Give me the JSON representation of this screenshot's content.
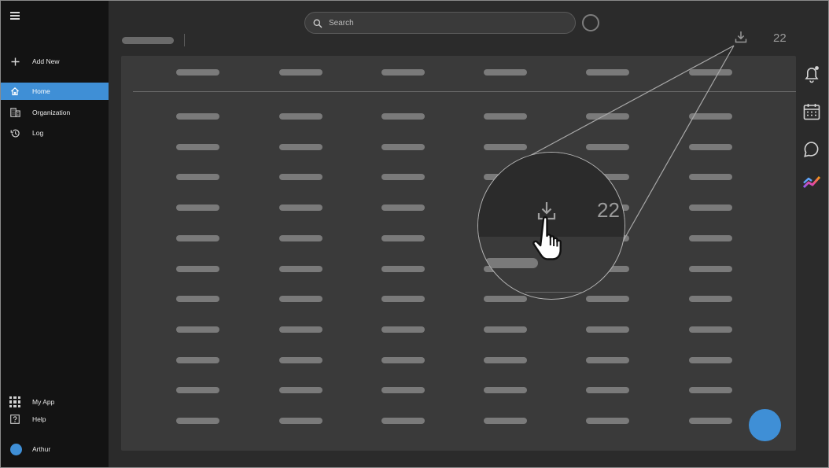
{
  "sidebar": {
    "add_new": "Add New",
    "items": [
      {
        "label": "Home",
        "icon": "home-icon",
        "active": true
      },
      {
        "label": "Organization",
        "icon": "building-icon",
        "active": false
      },
      {
        "label": "Log",
        "icon": "history-icon",
        "active": false
      }
    ],
    "bottom": {
      "my_app": "My App",
      "help": "Help",
      "user": "Arthur"
    }
  },
  "topbar": {
    "search_placeholder": "Search",
    "download_count": "22"
  },
  "zoom": {
    "download_count": "22"
  },
  "table": {
    "columns": 6,
    "rows": 11
  },
  "colors": {
    "accent": "#3f8fd6",
    "sidebar_bg": "#131313",
    "page_bg": "#2b2b2b",
    "card_bg": "#3a3a3a"
  }
}
